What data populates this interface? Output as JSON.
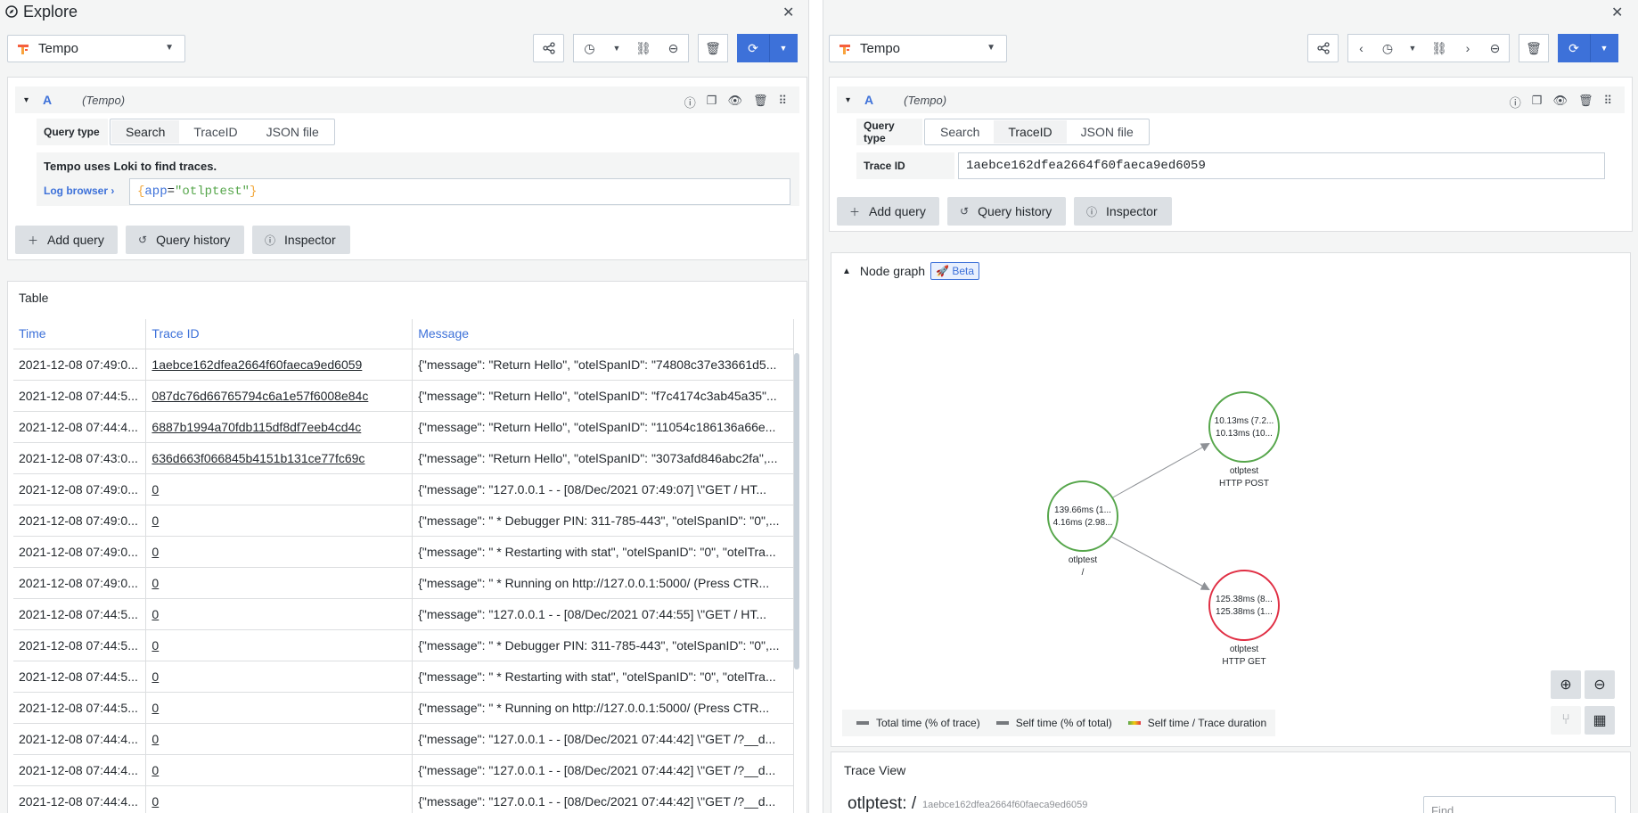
{
  "left": {
    "title": "Explore",
    "datasource": "Tempo",
    "query": {
      "letter": "A",
      "ds_label": "(Tempo)",
      "query_type_label": "Query type",
      "query_types": [
        "Search",
        "TraceID",
        "JSON file"
      ],
      "active_type": "Search",
      "info": "Tempo uses Loki to find traces.",
      "log_browser_label": "Log browser",
      "log_query": {
        "open": "{",
        "key": "app",
        "eq": "=",
        "val": "\"otlptest\"",
        "close": "}"
      }
    },
    "buttons": {
      "add_query": "Add query",
      "query_history": "Query history",
      "inspector": "Inspector"
    },
    "table": {
      "title": "Table",
      "columns": [
        "Time",
        "Trace ID",
        "Message"
      ],
      "rows": [
        [
          "2021-12-08 07:49:0...",
          "1aebce162dfea2664f60faeca9ed6059",
          "{\"message\": \"Return Hello\", \"otelSpanID\": \"74808c37e33661d5..."
        ],
        [
          "2021-12-08 07:44:5...",
          "087dc76d66765794c6a1e57f6008e84c",
          "{\"message\": \"Return Hello\", \"otelSpanID\": \"f7c4174c3ab45a35\"..."
        ],
        [
          "2021-12-08 07:44:4...",
          "6887b1994a70fdb115df8df7eeb4cd4c",
          "{\"message\": \"Return Hello\", \"otelSpanID\": \"11054c186136a66e..."
        ],
        [
          "2021-12-08 07:43:0...",
          "636d663f066845b4151b131ce77fc69c",
          "{\"message\": \"Return Hello\", \"otelSpanID\": \"3073afd846abc2fa\",..."
        ],
        [
          "2021-12-08 07:49:0...",
          "0",
          "{\"message\": \"127.0.0.1 - - [08/Dec/2021 07:49:07] \\\"GET / HT..."
        ],
        [
          "2021-12-08 07:49:0...",
          "0",
          "{\"message\": \" * Debugger PIN: 311-785-443\", \"otelSpanID\": \"0\",..."
        ],
        [
          "2021-12-08 07:49:0...",
          "0",
          "{\"message\": \" * Restarting with stat\", \"otelSpanID\": \"0\", \"otelTra..."
        ],
        [
          "2021-12-08 07:49:0...",
          "0",
          "{\"message\": \" * Running on http://127.0.0.1:5000/ (Press CTR..."
        ],
        [
          "2021-12-08 07:44:5...",
          "0",
          "{\"message\": \"127.0.0.1 - - [08/Dec/2021 07:44:55] \\\"GET / HT..."
        ],
        [
          "2021-12-08 07:44:5...",
          "0",
          "{\"message\": \" * Debugger PIN: 311-785-443\", \"otelSpanID\": \"0\",..."
        ],
        [
          "2021-12-08 07:44:5...",
          "0",
          "{\"message\": \" * Restarting with stat\", \"otelSpanID\": \"0\", \"otelTra..."
        ],
        [
          "2021-12-08 07:44:5...",
          "0",
          "{\"message\": \" * Running on http://127.0.0.1:5000/ (Press CTR..."
        ],
        [
          "2021-12-08 07:44:4...",
          "0",
          "{\"message\": \"127.0.0.1 - - [08/Dec/2021 07:44:42] \\\"GET /?__d..."
        ],
        [
          "2021-12-08 07:44:4...",
          "0",
          "{\"message\": \"127.0.0.1 - - [08/Dec/2021 07:44:42] \\\"GET /?__d..."
        ],
        [
          "2021-12-08 07:44:4...",
          "0",
          "{\"message\": \"127.0.0.1 - - [08/Dec/2021 07:44:42] \\\"GET /?__d..."
        ]
      ]
    }
  },
  "right": {
    "datasource": "Tempo",
    "query": {
      "letter": "A",
      "ds_label": "(Tempo)",
      "query_type_label": "Query type",
      "query_types": [
        "Search",
        "TraceID",
        "JSON file"
      ],
      "active_type": "TraceID",
      "trace_id_label": "Trace ID",
      "trace_id_value": "1aebce162dfea2664f60faeca9ed6059"
    },
    "buttons": {
      "add_query": "Add query",
      "query_history": "Query history",
      "inspector": "Inspector"
    },
    "node_graph": {
      "title": "Node graph",
      "badge": "Beta",
      "nodes": [
        {
          "line1": "139.66ms (1...",
          "line2": "4.16ms (2.98...",
          "name": "otlptest",
          "sub": "/",
          "color": "#56a64b"
        },
        {
          "line1": "10.13ms (7.2...",
          "line2": "10.13ms (10...",
          "name": "otlptest",
          "sub": "HTTP POST",
          "color": "#56a64b"
        },
        {
          "line1": "125.38ms (8...",
          "line2": "125.38ms (1...",
          "name": "otlptest",
          "sub": "HTTP GET",
          "color": "#e02f44"
        }
      ],
      "legend": [
        "Total time (% of trace)",
        "Self time (% of total)",
        "Self time / Trace duration"
      ]
    },
    "trace_view": {
      "title": "Trace View",
      "name": "otlptest: /",
      "id": "1aebce162dfea2664f60faeca9ed6059",
      "find_placeholder": "Find"
    }
  }
}
